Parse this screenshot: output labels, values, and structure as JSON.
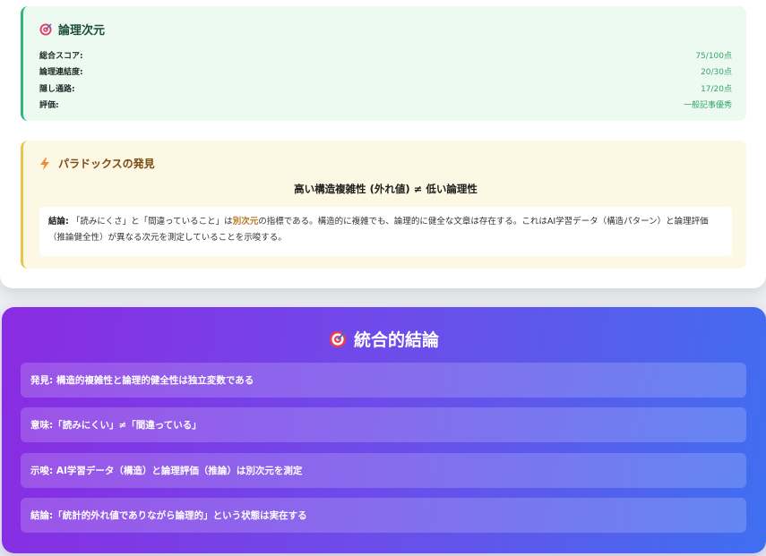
{
  "logic": {
    "title": "論理次元",
    "icon": "target-icon",
    "rows": [
      {
        "label": "総合スコア:",
        "value": "75/100点"
      },
      {
        "label": "論理連結度:",
        "value": "20/30点"
      },
      {
        "label": "隠し通路:",
        "value": "17/20点"
      },
      {
        "label": "評価:",
        "value": "一般記事優秀"
      }
    ]
  },
  "paradox": {
    "title": "パラドックスの発見",
    "icon": "lightning-icon",
    "formula": "高い構造複雑性 (外れ値) ≠ 低い論理性",
    "conclusion_prefix": "結論:",
    "conclusion_part1": "「読みにくさ」と「間違っていること」は",
    "conclusion_highlight": "別次元",
    "conclusion_part2": "の指標である。構造的に複雑でも、論理的に健全な文章は存在する。これはAI学習データ（構造パターン）と論理評価（推論健全性）が異なる次元を測定していることを示唆する。"
  },
  "final": {
    "title": "統合的結論",
    "icon": "target-icon",
    "items": [
      "発見: 構造的複雑性と論理的健全性は独立変数である",
      "意味:「読みにくい」≠「間違っている」",
      "示唆: AI学習データ（構造）と論理評価（推論）は別次元を測定",
      "結論:「統計的外れ値でありながら論理的」という状態は実在する"
    ]
  },
  "colors": {
    "logic_accent": "#2fb67a",
    "paradox_accent": "#e8c64a",
    "gradient_start": "#8a2be2",
    "gradient_end": "#3f6ff0"
  }
}
